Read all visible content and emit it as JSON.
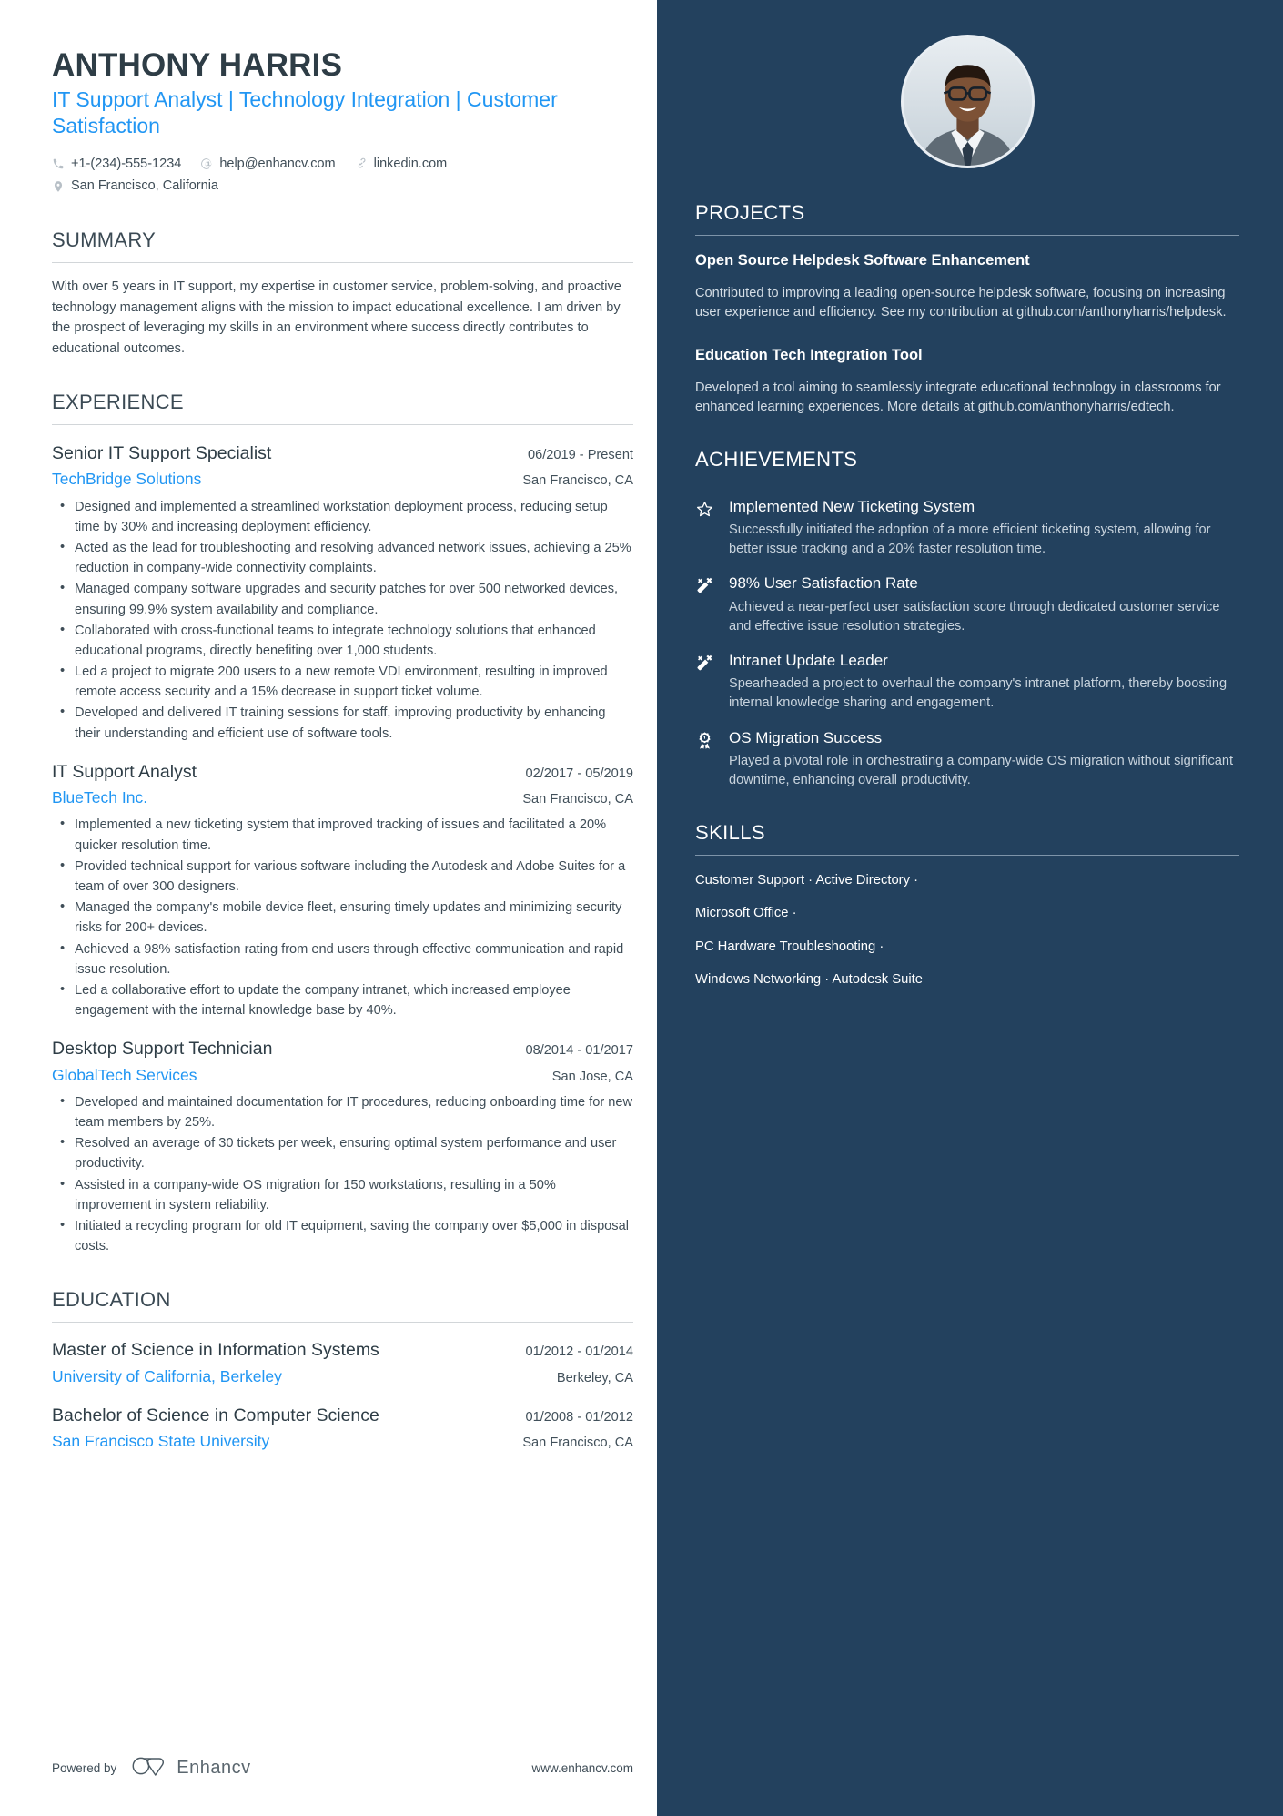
{
  "header": {
    "name": "ANTHONY HARRIS",
    "headline": "IT Support Analyst | Technology Integration | Customer Satisfaction",
    "contacts": [
      {
        "icon": "phone-icon",
        "text": "+1-(234)-555-1234"
      },
      {
        "icon": "email-icon",
        "text": "help@enhancv.com"
      },
      {
        "icon": "link-icon",
        "text": "linkedin.com"
      },
      {
        "icon": "location-pin-icon",
        "text": "San Francisco, California"
      }
    ]
  },
  "summary": {
    "title": "SUMMARY",
    "text": "With over 5 years in IT support, my expertise in customer service, problem-solving, and proactive technology management aligns with the mission to impact educational excellence. I am driven by the prospect of leveraging my skills in an environment where success directly contributes to educational outcomes."
  },
  "experience": {
    "title": "EXPERIENCE",
    "entries": [
      {
        "title": "Senior IT Support Specialist",
        "dates": "06/2019 - Present",
        "org": "TechBridge Solutions",
        "location": "San Francisco, CA",
        "bullets": [
          "Designed and implemented a streamlined workstation deployment process, reducing setup time by 30% and increasing deployment efficiency.",
          "Acted as the lead for troubleshooting and resolving advanced network issues, achieving a 25% reduction in company-wide connectivity complaints.",
          "Managed company software upgrades and security patches for over 500 networked devices, ensuring 99.9% system availability and compliance.",
          "Collaborated with cross-functional teams to integrate technology solutions that enhanced educational programs, directly benefiting over 1,000 students.",
          "Led a project to migrate 200 users to a new remote VDI environment, resulting in improved remote access security and a 15% decrease in support ticket volume.",
          "Developed and delivered IT training sessions for staff, improving productivity by enhancing their understanding and efficient use of software tools."
        ]
      },
      {
        "title": "IT Support Analyst",
        "dates": "02/2017 - 05/2019",
        "org": "BlueTech Inc.",
        "location": "San Francisco, CA",
        "bullets": [
          "Implemented a new ticketing system that improved tracking of issues and facilitated a 20% quicker resolution time.",
          "Provided technical support for various software including the Autodesk and Adobe Suites for a team of over 300 designers.",
          "Managed the company's mobile device fleet, ensuring timely updates and minimizing security risks for 200+ devices.",
          "Achieved a 98% satisfaction rating from end users through effective communication and rapid issue resolution.",
          "Led a collaborative effort to update the company intranet, which increased employee engagement with the internal knowledge base by 40%."
        ]
      },
      {
        "title": "Desktop Support Technician",
        "dates": "08/2014 - 01/2017",
        "org": "GlobalTech Services",
        "location": "San Jose, CA",
        "bullets": [
          "Developed and maintained documentation for IT procedures, reducing onboarding time for new team members by 25%.",
          "Resolved an average of 30 tickets per week, ensuring optimal system performance and user productivity.",
          "Assisted in a company-wide OS migration for 150 workstations, resulting in a 50% improvement in system reliability.",
          "Initiated a recycling program for old IT equipment, saving the company over $5,000 in disposal costs."
        ]
      }
    ]
  },
  "education": {
    "title": "EDUCATION",
    "entries": [
      {
        "title": "Master of Science in Information Systems",
        "dates": "01/2012 - 01/2014",
        "org": "University of California, Berkeley",
        "location": "Berkeley, CA"
      },
      {
        "title": "Bachelor of Science in Computer Science",
        "dates": "01/2008 - 01/2012",
        "org": "San Francisco State University",
        "location": "San Francisco, CA"
      }
    ]
  },
  "footer": {
    "powered_by": "Powered by",
    "brand": "Enhancv",
    "site": "www.enhancv.com"
  },
  "sidebar": {
    "projects": {
      "title": "PROJECTS",
      "items": [
        {
          "title": "Open Source Helpdesk Software Enhancement",
          "description": "Contributed to improving a leading open-source helpdesk software, focusing on increasing user experience and efficiency. See my contribution at github.com/anthonyharris/helpdesk."
        },
        {
          "title": "Education Tech Integration Tool",
          "description": "Developed a tool aiming to seamlessly integrate educational technology in classrooms for enhanced learning experiences. More details at github.com/anthonyharris/edtech."
        }
      ]
    },
    "achievements": {
      "title": "ACHIEVEMENTS",
      "items": [
        {
          "icon": "star-icon",
          "title": "Implemented New Ticketing System",
          "description": "Successfully initiated the adoption of a more efficient ticketing system, allowing for better issue tracking and a 20% faster resolution time."
        },
        {
          "icon": "magic-wand-icon",
          "title": "98% User Satisfaction Rate",
          "description": "Achieved a near-perfect user satisfaction score through dedicated customer service and effective issue resolution strategies."
        },
        {
          "icon": "magic-wand-icon",
          "title": "Intranet Update Leader",
          "description": "Spearheaded a project to overhaul the company's intranet platform, thereby boosting internal knowledge sharing and engagement."
        },
        {
          "icon": "award-ribbon-icon",
          "title": "OS Migration Success",
          "description": "Played a pivotal role in orchestrating a company-wide OS migration without significant downtime, enhancing overall productivity."
        }
      ]
    },
    "skills": {
      "title": "SKILLS",
      "lines": [
        "Customer Support · Active Directory ·",
        "Microsoft Office ·",
        "PC Hardware Troubleshooting ·",
        "Windows Networking · Autodesk Suite"
      ]
    }
  },
  "colors": {
    "accent_blue": "#2196f3",
    "sidebar_navy": "#23415e",
    "body_text": "#3f4d57",
    "heading_text": "#2e3d46"
  }
}
